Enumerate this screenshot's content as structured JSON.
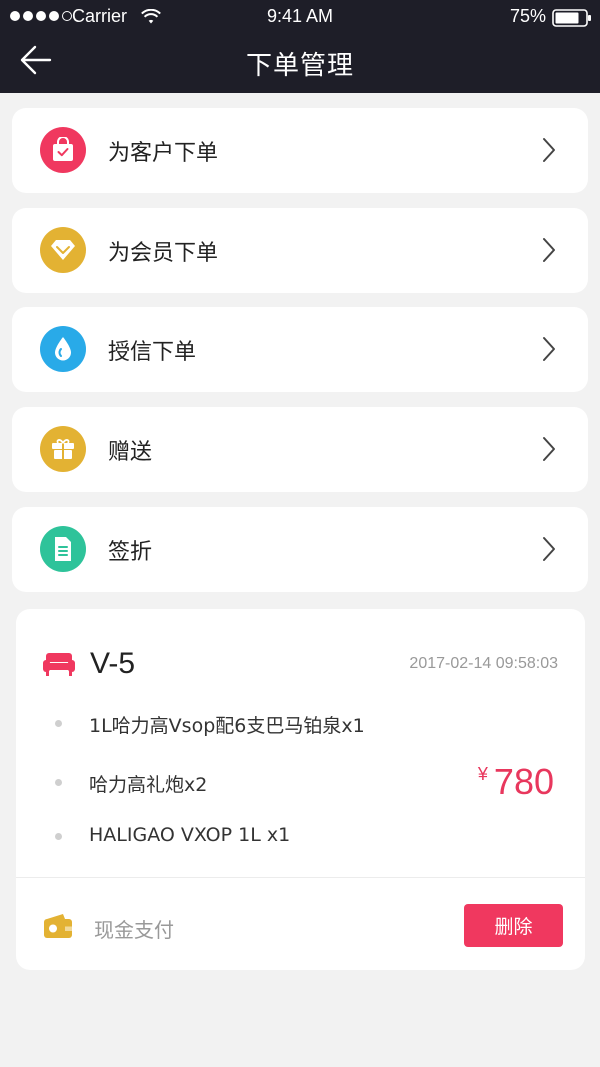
{
  "status_bar": {
    "carrier": "Carrier",
    "time": "9:41 AM",
    "battery": "75%"
  },
  "nav": {
    "title": "下单管理",
    "back_icon": "arrow-left-icon"
  },
  "menu": [
    {
      "label": "为客户下单",
      "icon": "bag-check-icon",
      "color": "#f0385f"
    },
    {
      "label": "为会员下单",
      "icon": "diamond-icon",
      "color": "#e3b233"
    },
    {
      "label": "授信下单",
      "icon": "drop-icon",
      "color": "#29aae8"
    },
    {
      "label": "赠送",
      "icon": "gift-icon",
      "color": "#e3b233"
    },
    {
      "label": "签折",
      "icon": "receipt-icon",
      "color": "#2ec39a"
    }
  ],
  "order": {
    "table": "V-5",
    "time": "2017-02-14 09:58:03",
    "items": [
      "1L哈力高Vsop配6支巴马铂泉x1",
      "哈力高礼炮x2",
      "HALIGAO VXOP 1L x1"
    ],
    "currency": "¥",
    "total": "780",
    "payment_method": "现金支付",
    "delete_label": "删除"
  },
  "colors": {
    "header_bg": "#1e1e28",
    "accent": "#f0385f",
    "background": "#f2f2f2"
  }
}
